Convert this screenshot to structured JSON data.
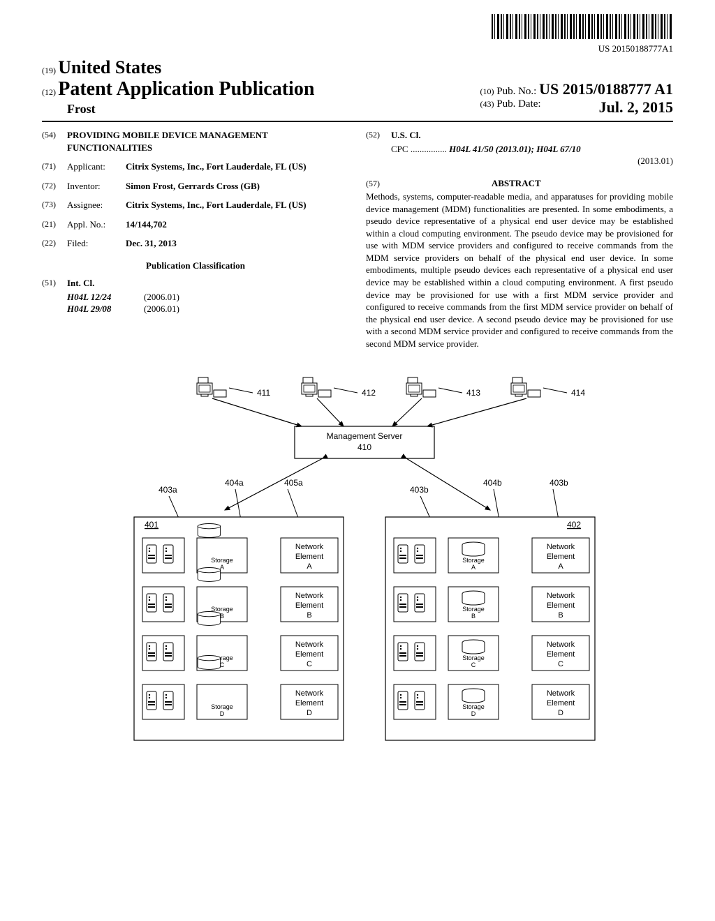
{
  "barcode_number": "US 20150188777A1",
  "header": {
    "code19": "(19)",
    "country": "United States",
    "code12": "(12)",
    "doc_type": "Patent Application Publication",
    "author": "Frost",
    "code10": "(10)",
    "pubno_label": "Pub. No.:",
    "pubno": "US 2015/0188777 A1",
    "code43": "(43)",
    "pubdate_label": "Pub. Date:",
    "pubdate": "Jul. 2, 2015"
  },
  "biblio": {
    "f54": {
      "code": "(54)",
      "title": "PROVIDING MOBILE DEVICE MANAGEMENT FUNCTIONALITIES"
    },
    "f71": {
      "code": "(71)",
      "label": "Applicant:",
      "value": "Citrix Systems, Inc., Fort Lauderdale, FL (US)"
    },
    "f72": {
      "code": "(72)",
      "label": "Inventor:",
      "value": "Simon Frost, Gerrards Cross (GB)"
    },
    "f73": {
      "code": "(73)",
      "label": "Assignee:",
      "value": "Citrix Systems, Inc., Fort Lauderdale, FL (US)"
    },
    "f21": {
      "code": "(21)",
      "label": "Appl. No.:",
      "value": "14/144,702"
    },
    "f22": {
      "code": "(22)",
      "label": "Filed:",
      "value": "Dec. 31, 2013"
    },
    "pub_class_heading": "Publication Classification",
    "f51": {
      "code": "(51)",
      "label": "Int. Cl.",
      "rows": [
        {
          "cls": "H04L 12/24",
          "ver": "(2006.01)"
        },
        {
          "cls": "H04L 29/08",
          "ver": "(2006.01)"
        }
      ]
    },
    "f52": {
      "code": "(52)",
      "label": "U.S. Cl.",
      "line1_prefix": "CPC ................",
      "line1": "H04L 41/50 (2013.01); H04L 67/10",
      "line2": "(2013.01)"
    },
    "f57": {
      "code": "(57)",
      "heading": "ABSTRACT",
      "text": "Methods, systems, computer-readable media, and apparatuses for providing mobile device management (MDM) functionalities are presented. In some embodiments, a pseudo device representative of a physical end user device may be established within a cloud computing environment. The pseudo device may be provisioned for use with MDM service providers and configured to receive commands from the MDM service providers on behalf of the physical end user device. In some embodiments, multiple pseudo devices each representative of a physical end user device may be established within a cloud computing environment. A first pseudo device may be provisioned for use with a first MDM service provider and configured to receive commands from the first MDM service provider on behalf of the physical end user device. A second pseudo device may be provisioned for use with a second MDM service provider and configured to receive commands from the second MDM service provider."
    }
  },
  "figure": {
    "mgmt_server": "Management Server",
    "mgmt_server_num": "410",
    "top_refs": [
      "411",
      "412",
      "413",
      "414"
    ],
    "left_block_ref": "401",
    "right_block_ref": "402",
    "left_leads": {
      "a": "403a",
      "b": "404a",
      "c": "405a"
    },
    "right_leads": {
      "a": "403b",
      "b": "404b",
      "c": "403b"
    },
    "storage_prefix": "Storage",
    "storage_suffixes": [
      "A",
      "B",
      "C",
      "D"
    ],
    "netelem_line1": "Network",
    "netelem_line2": "Element",
    "netelem_suffixes": [
      "A",
      "B",
      "C",
      "D"
    ]
  }
}
